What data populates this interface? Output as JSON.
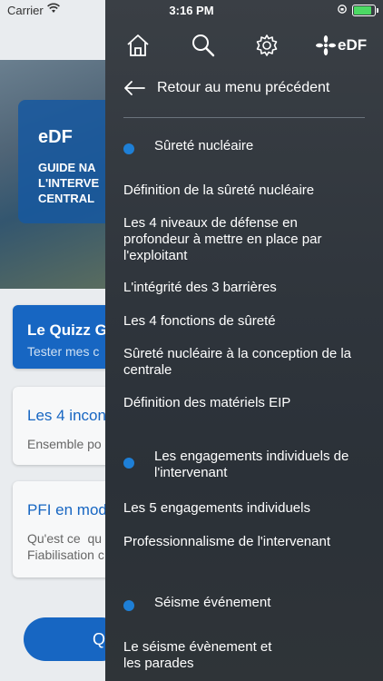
{
  "status_bar": {
    "carrier": "Carrier",
    "time": "3:16 PM"
  },
  "background": {
    "hero": {
      "logo_text": "eDF",
      "title": "GUIDE NA\nL'INTERVE\nCENTRAL"
    },
    "cards": [
      {
        "title": "Le Quizz G",
        "subtitle": "Tester mes c"
      },
      {
        "title": "Les 4 incon",
        "subtitle": "Ensemble po"
      },
      {
        "title": "PFI en mod",
        "subtitle": "Qu'est ce  qu\nFiabilisation c"
      }
    ]
  },
  "drawer": {
    "logo_text": "eDF",
    "back_label": "Retour au menu précédent",
    "sections": [
      {
        "label": "Sûreté nucléaire"
      },
      {
        "label": "Les engagements individuels de l'intervenant"
      },
      {
        "label": "Séisme événement"
      }
    ],
    "items": [
      "Définition de la sûreté nucléaire",
      "Les 4 niveaux de défense en profondeur à mettre en place par l'exploitant",
      "L'intégrité des 3 barrières",
      "Les 4 fonctions de sûreté",
      "Sûreté nucléaire à la conception de la centrale",
      "Définition des matériels EIP",
      "Les 5 engagements individuels",
      "Professionnalisme de l'intervenant",
      "Le séisme évènement et les parades"
    ]
  },
  "colors": {
    "accent": "#1e7fd6",
    "drawer_bg": "#31373e",
    "brand_blue": "#1766c2"
  }
}
